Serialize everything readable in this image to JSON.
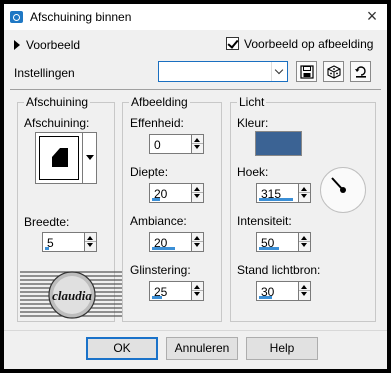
{
  "window": {
    "title": "Afschuining binnen"
  },
  "preview": {
    "expander_label": "Voorbeeld",
    "preview_on_image_label": "Voorbeeld op afbeelding",
    "preview_on_image_checked": true
  },
  "settings": {
    "label": "Instellingen",
    "value": ""
  },
  "bevel": {
    "group_title": "Afschuining",
    "bevel_label": "Afschuining:",
    "width_label": "Breedte:",
    "width_value": "5",
    "width_fill": 0.05
  },
  "image": {
    "group_title": "Afbeelding",
    "smoothness_label": "Effenheid:",
    "smoothness_value": "0",
    "smoothness_fill": 0,
    "depth_label": "Diepte:",
    "depth_value": "20",
    "depth_fill": 0.2,
    "ambience_label": "Ambiance:",
    "ambience_value": "20",
    "ambience_fill": 0.6,
    "shininess_label": "Glinstering:",
    "shininess_value": "25",
    "shininess_fill": 0.25
  },
  "light": {
    "group_title": "Licht",
    "color_label": "Kleur:",
    "color": "#3b6394",
    "angle_label": "Hoek:",
    "angle_value": "315",
    "angle_fill": 0.87,
    "intensity_label": "Intensiteit:",
    "intensity_value": "50",
    "intensity_fill": 0.5,
    "elevation_label": "Stand lichtbron:",
    "elevation_value": "30",
    "elevation_fill": 0.33
  },
  "watermark": {
    "text": "claudia"
  },
  "buttons": {
    "ok": "OK",
    "cancel": "Annuleren",
    "help": "Help"
  },
  "colors": {
    "accent": "#1a72c9",
    "slider_fill": "#3b8fd6"
  }
}
